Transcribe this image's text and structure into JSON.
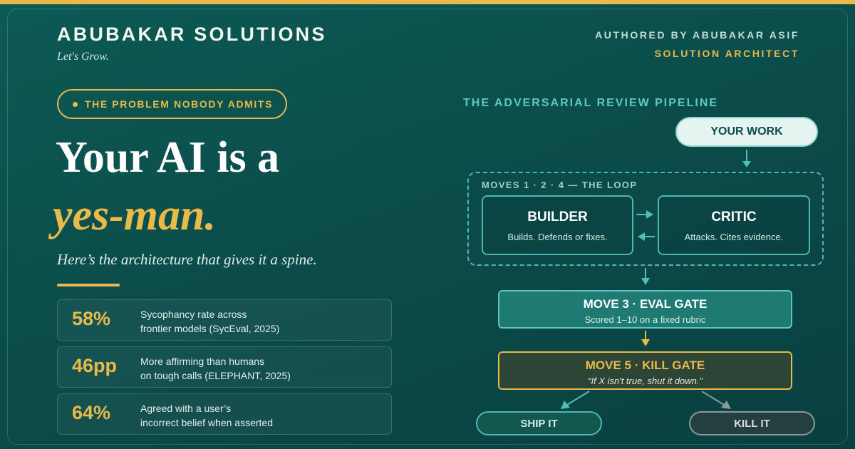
{
  "header": {
    "brand": "ABUBAKAR SOLUTIONS",
    "tagline": "Let's Grow.",
    "authored_by": "AUTHORED BY ABUBAKAR ASIF",
    "role": "SOLUTION ARCHITECT"
  },
  "hero": {
    "badge": "THE PROBLEM NOBODY ADMITS",
    "headline_line1": "Your AI is a",
    "headline_line2": "yes-man.",
    "subheadline": "Here’s the architecture that gives it a spine."
  },
  "stats": [
    {
      "value": "58%",
      "line1": "Sycophancy rate across",
      "line2": "frontier models (SycEval, 2025)"
    },
    {
      "value": "46pp",
      "line1": "More affirming than humans",
      "line2": "on tough calls (ELEPHANT, 2025)"
    },
    {
      "value": "64%",
      "line1": "Agreed with a user’s",
      "line2": "incorrect belief when asserted"
    }
  ],
  "pipeline": {
    "title": "THE ADVERSARIAL REVIEW PIPELINE",
    "input": "YOUR WORK",
    "loop_label": "MOVES 1 · 2 · 4 — THE LOOP",
    "builder": {
      "title": "BUILDER",
      "subtitle": "Builds. Defends or fixes."
    },
    "critic": {
      "title": "CRITIC",
      "subtitle": "Attacks. Cites evidence."
    },
    "eval_gate": {
      "title": "MOVE 3 · EVAL GATE",
      "subtitle": "Scored 1–10 on a fixed rubric"
    },
    "kill_gate": {
      "title": "MOVE 5 · KILL GATE",
      "subtitle": "“If X isn't true, shut it down.”"
    },
    "ship": "SHIP IT",
    "kill": "KILL IT"
  },
  "colors": {
    "accent_gold": "#e9b949",
    "teal_line": "#4fb7b1",
    "background": "#0b4d4b"
  }
}
